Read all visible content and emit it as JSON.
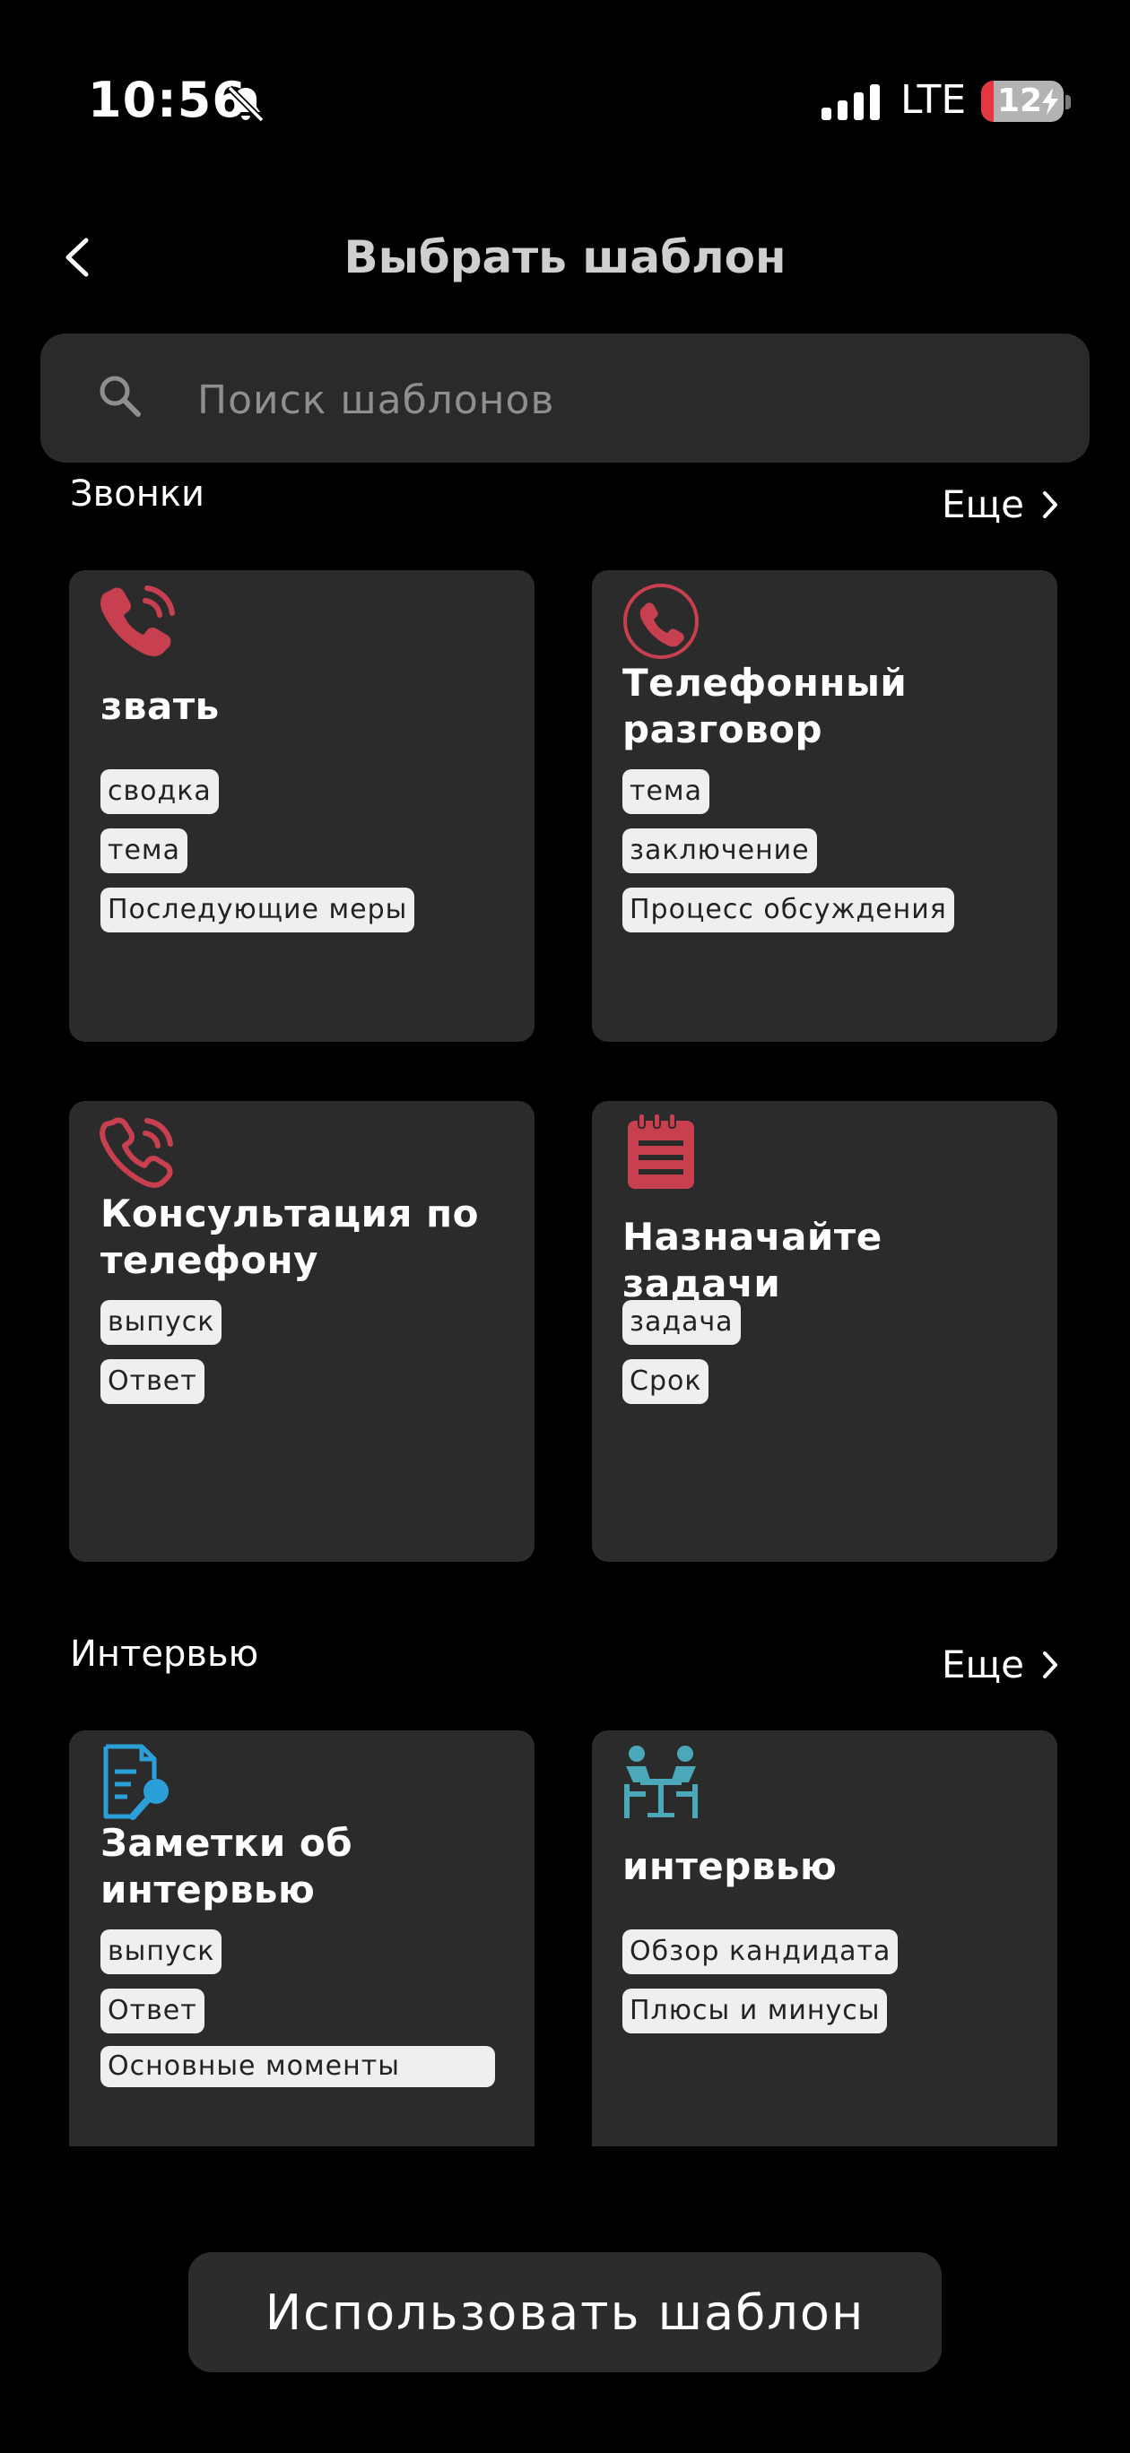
{
  "status_bar": {
    "time": "10:56",
    "network": "LTE",
    "battery": "12"
  },
  "header": {
    "title": "Выбрать шаблон"
  },
  "search": {
    "placeholder": "Поиск шаблонов"
  },
  "sections": [
    {
      "title": "Звонки",
      "more_label": "Еще",
      "cards": [
        {
          "title": "звать",
          "icon": "phone-ringing-icon",
          "tags": [
            "сводка",
            "тема",
            "Последующие меры"
          ]
        },
        {
          "title": "Телефонный разговор",
          "icon": "phone-circle-icon",
          "tags": [
            "тема",
            "заключение",
            "Процесс обсуждения"
          ]
        },
        {
          "title": "Консультация по телефону",
          "icon": "phone-call-outline-icon",
          "tags": [
            "выпуск",
            "Ответ"
          ]
        },
        {
          "title": "Назначайте задачи",
          "icon": "notepad-icon",
          "tags": [
            "задача",
            "Срок"
          ]
        }
      ]
    },
    {
      "title": "Интервью",
      "more_label": "Еще",
      "cards": [
        {
          "title": "Заметки об интервью",
          "icon": "document-microphone-icon",
          "tags": [
            "выпуск",
            "Ответ",
            "Основные моменты"
          ]
        },
        {
          "title": "интервью",
          "icon": "meeting-table-icon",
          "tags": [
            "Обзор кандидата",
            "Плюсы и минусы"
          ]
        }
      ]
    }
  ],
  "footer": {
    "use_button": "Использовать шаблон"
  },
  "colors": {
    "accent_red": "#c8404f",
    "accent_blue": "#2a9fd8",
    "accent_teal": "#4aa8b8",
    "card_bg": "#2b2b2b"
  }
}
